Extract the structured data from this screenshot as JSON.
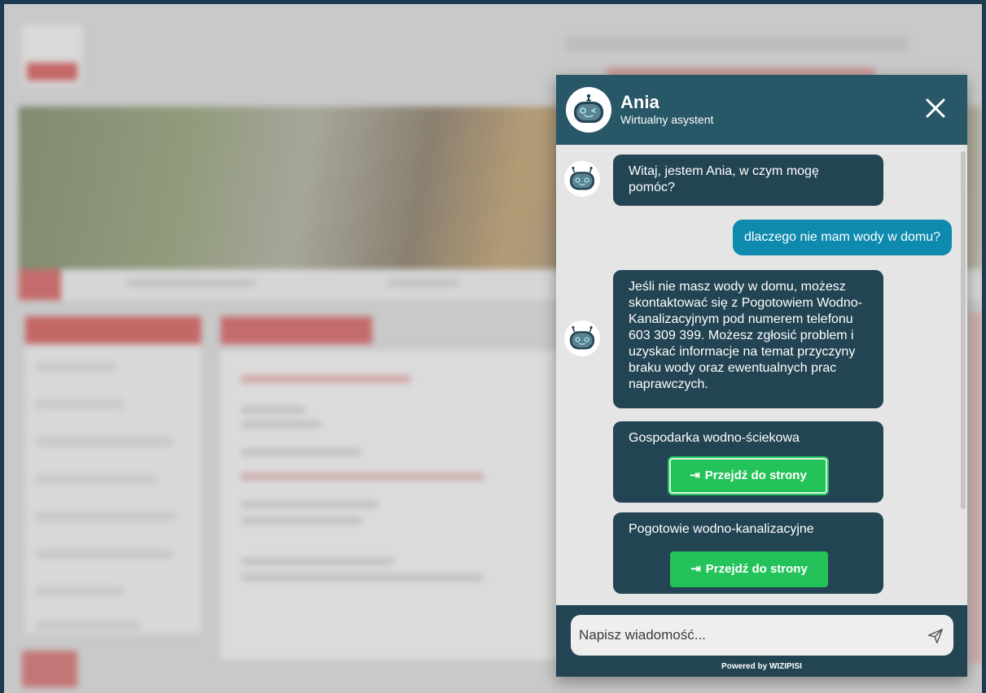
{
  "assistant": {
    "name": "Ania",
    "subtitle": "Wirtualny asystent"
  },
  "messages": {
    "bot_greeting": "Witaj, jestem Ania, w czym mogę pomóc?",
    "user_question": "dlaczego nie mam wody w domu?",
    "bot_answer": "Jeśli nie masz wody w domu, możesz skontaktować się z Pogotowiem Wodno-Kanalizacyjnym pod numerem telefonu 603 309 399. Możesz zgłosić problem i uzyskać informacje na temat przyczyny braku wody oraz ewentualnych prac naprawczych."
  },
  "cards": [
    {
      "title": "Gospodarka wodno-ściekowa",
      "button_label": "Przejdź do strony"
    },
    {
      "title": "Pogotowie wodno-kanalizacyjne",
      "button_label": "Przejdź do strony"
    }
  ],
  "input": {
    "placeholder": "Napisz wiadomość..."
  },
  "footer": {
    "powered_by": "Powered by WIZIPISI"
  },
  "icons": {
    "close": "close-icon",
    "send": "send-icon",
    "enter": "arrow-right-to-bracket-icon",
    "avatar": "robot-avatar-icon"
  },
  "colors": {
    "header": "#285767",
    "bot_bubble": "#234453",
    "user_bubble": "#0f8aaf",
    "button": "#23c35a"
  }
}
